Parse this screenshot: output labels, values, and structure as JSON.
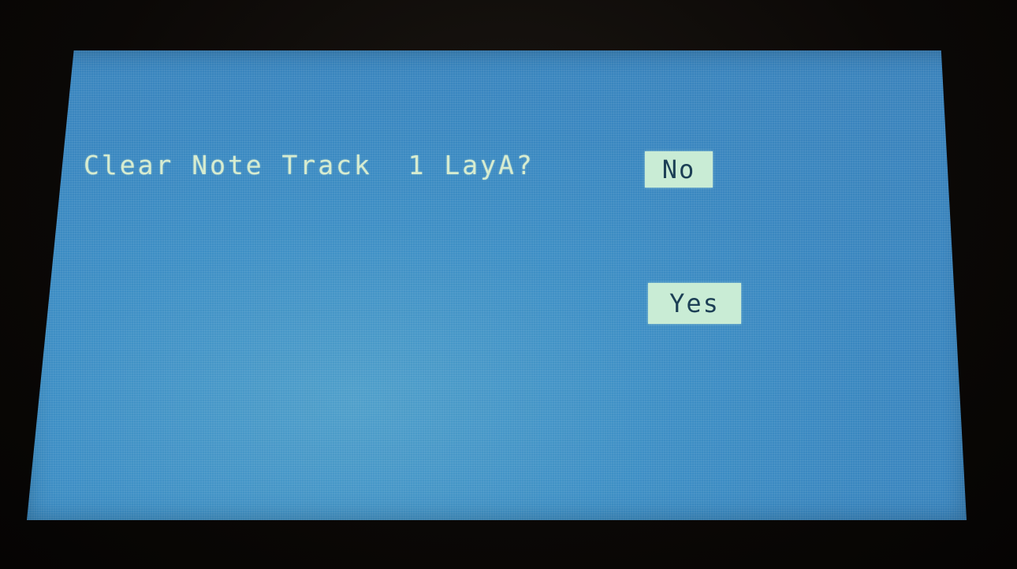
{
  "dialog": {
    "prompt": "Clear Note Track  1 LayA?",
    "no_label": "No",
    "yes_label": "Yes"
  },
  "colors": {
    "screen_background": "#3e8fc5",
    "text": "#d7ecd0",
    "button_background": "#c9ecd5",
    "button_text": "#1c3f55",
    "bezel": "#0c0907"
  }
}
